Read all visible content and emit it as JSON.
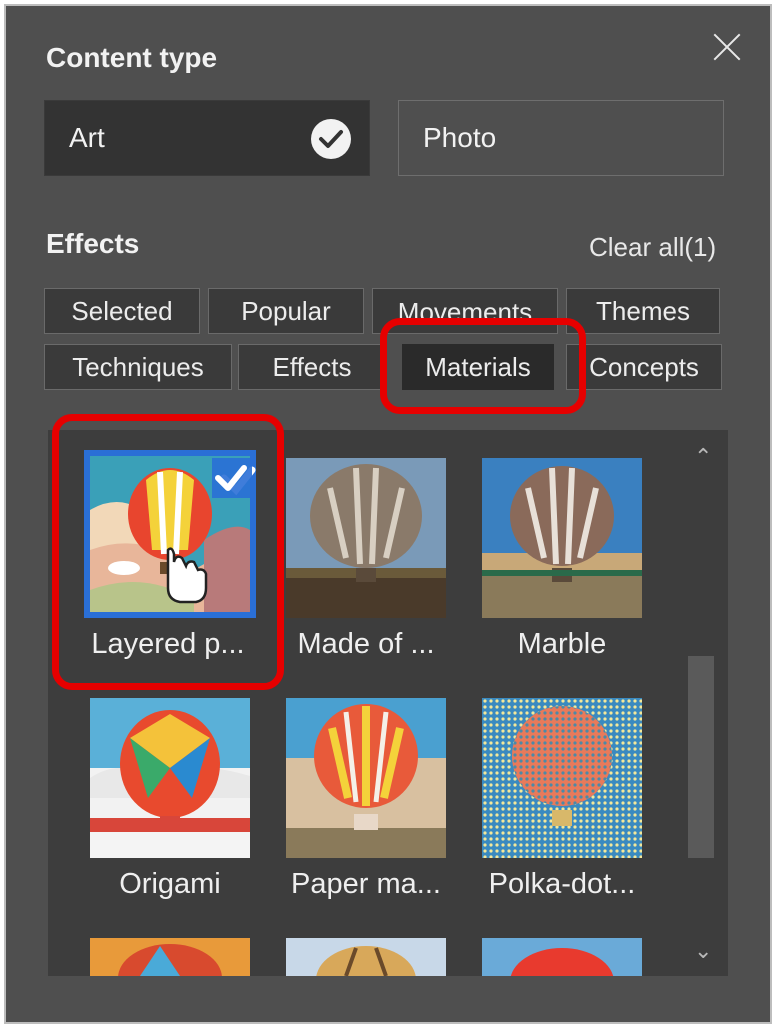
{
  "panel": {
    "content_type_title": "Content type",
    "content_types": [
      {
        "label": "Art",
        "selected": true
      },
      {
        "label": "Photo",
        "selected": false
      }
    ],
    "effects_title": "Effects",
    "clear_all": "Clear all(1)",
    "filter_tabs_row1": [
      "Selected",
      "Popular",
      "Movements",
      "Themes"
    ],
    "filter_tabs_row2": [
      "Techniques",
      "Effects",
      "Materials",
      "Concepts"
    ],
    "selected_tab": "Materials",
    "thumbnails": [
      {
        "label": "Layered p...",
        "selected": true
      },
      {
        "label": "Made of ...",
        "selected": false
      },
      {
        "label": "Marble",
        "selected": false
      },
      {
        "label": "Origami",
        "selected": false
      },
      {
        "label": "Paper ma...",
        "selected": false
      },
      {
        "label": "Polka-dot...",
        "selected": false
      }
    ],
    "icons": {
      "close": "close-icon",
      "check": "check-icon",
      "scroll_up": "chevron-up-icon",
      "scroll_down": "chevron-down-icon",
      "cursor": "hand-pointer-icon"
    },
    "colors": {
      "panel_bg": "#4f4f4f",
      "highlight": "#e60000",
      "selected_blue": "#2a6fd6"
    }
  }
}
